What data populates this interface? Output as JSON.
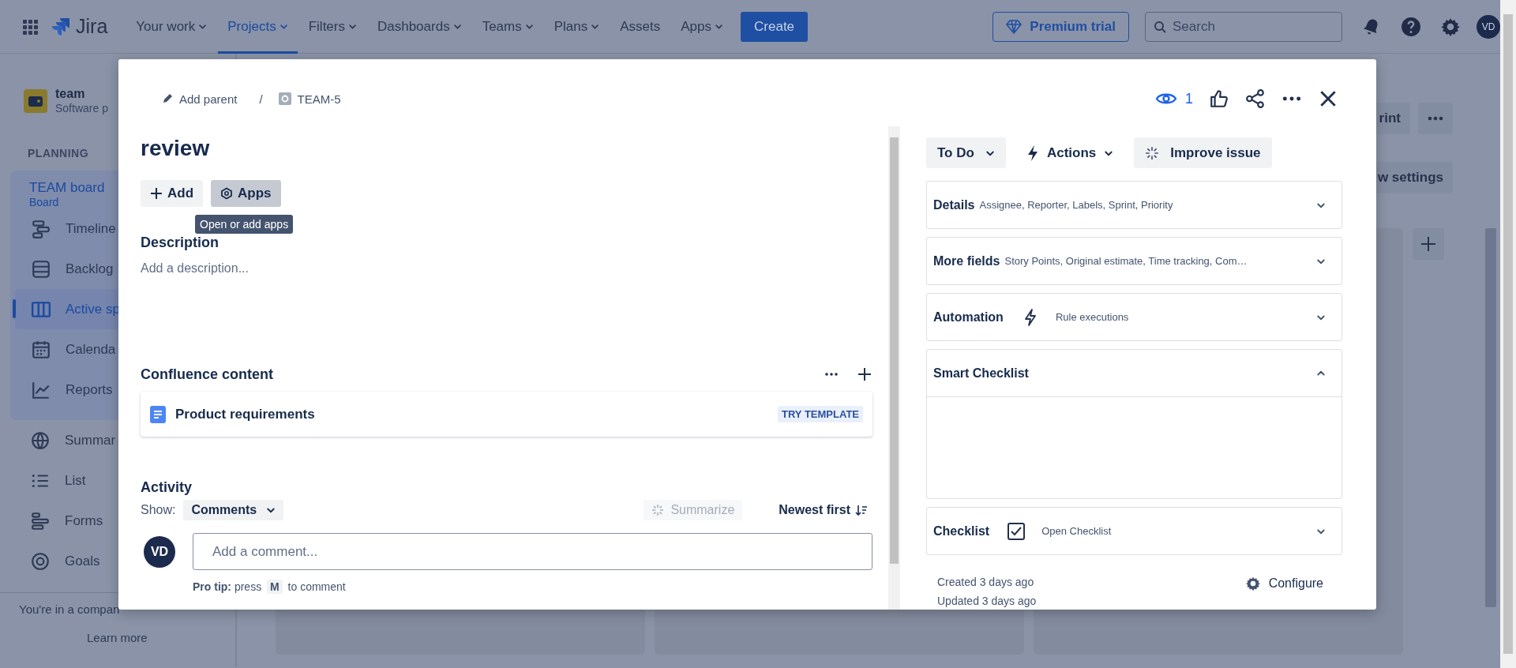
{
  "top_nav": {
    "app_name": "Jira",
    "items": [
      {
        "label": "Your work",
        "dropdown": true,
        "selected": false
      },
      {
        "label": "Projects",
        "dropdown": true,
        "selected": true
      },
      {
        "label": "Filters",
        "dropdown": true,
        "selected": false
      },
      {
        "label": "Dashboards",
        "dropdown": true,
        "selected": false
      },
      {
        "label": "Teams",
        "dropdown": true,
        "selected": false
      },
      {
        "label": "Plans",
        "dropdown": true,
        "selected": false
      },
      {
        "label": "Assets",
        "dropdown": false,
        "selected": false
      },
      {
        "label": "Apps",
        "dropdown": true,
        "selected": false
      }
    ],
    "create_button": "Create",
    "premium_button": "Premium trial",
    "search": {
      "placeholder": "Search"
    },
    "avatar": "VD"
  },
  "sidebar": {
    "project_name": "team",
    "project_type": "Software p",
    "section_title": "PLANNING",
    "board_name": "TEAM board",
    "board_type": "Board",
    "planning_items": [
      {
        "label": "Timeline",
        "selected": false
      },
      {
        "label": "Backlog",
        "selected": false
      },
      {
        "label": "Active sp",
        "selected": true
      },
      {
        "label": "Calenda",
        "selected": false
      },
      {
        "label": "Reports",
        "selected": false
      }
    ],
    "items": [
      {
        "label": "Summar"
      },
      {
        "label": "List"
      },
      {
        "label": "Forms"
      },
      {
        "label": "Goals"
      }
    ],
    "footer_text": "You're in a compan",
    "footer_link": "Learn more"
  },
  "board": {
    "buttons": [
      "rint",
      "w settings"
    ]
  },
  "issue": {
    "breadcrumb": {
      "add_parent": "Add parent",
      "separator": "/",
      "issue_key": "TEAM-5"
    },
    "watchers": "1",
    "title": "review",
    "buttons": [
      {
        "label": "Add",
        "hovered": false
      },
      {
        "label": "Apps",
        "hovered": true
      }
    ],
    "tooltip": "Open or add apps",
    "description": {
      "heading": "Description",
      "placeholder": "Add a description..."
    },
    "confluence": {
      "heading": "Confluence content",
      "item": "Product requirements",
      "badge": "TRY TEMPLATE"
    },
    "activity": {
      "heading": "Activity",
      "show_label": "Show:",
      "filter": "Comments",
      "summarize": {
        "label": "Summarize",
        "disabled": true
      },
      "sort": "Newest first"
    },
    "comment": {
      "avatar": "VD",
      "placeholder": "Add a comment...",
      "tip_label": "Pro tip:",
      "tip_before": "press",
      "tip_key": "M",
      "tip_after": "to comment"
    },
    "status": "To Do",
    "actions": "Actions",
    "improve": "Improve issue",
    "panels": [
      {
        "kind": "summary",
        "title": "Details",
        "summary": "Assignee, Reporter, Labels, Sprint, Priority",
        "expanded": false
      },
      {
        "kind": "summary",
        "title": "More fields",
        "summary": "Story Points, Original estimate, Time tracking, Com…",
        "expanded": false
      },
      {
        "kind": "automation",
        "title": "Automation",
        "summary": "Rule executions",
        "expanded": false
      },
      {
        "kind": "section",
        "title": "Smart Checklist",
        "expanded": true
      },
      {
        "kind": "checklist",
        "title": "Checklist",
        "summary": "Open Checklist",
        "expanded": false
      }
    ],
    "created": "Created 3 days ago",
    "updated": "Updated 3 days ago",
    "configure": "Configure"
  }
}
